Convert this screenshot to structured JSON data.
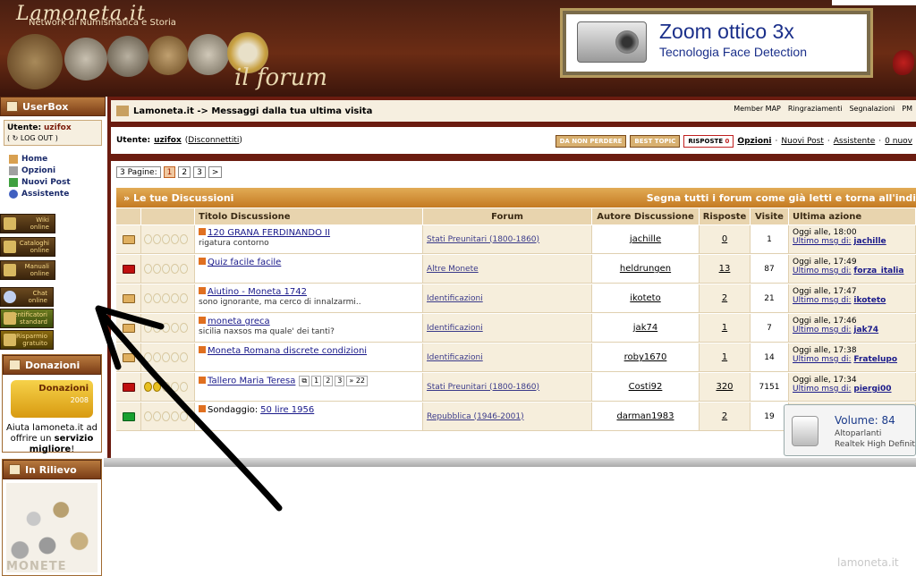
{
  "header": {
    "logo_title": "Lamoneta.it",
    "logo_subtitle": "Network di Numismatica e Storia",
    "forum_word": "il forum",
    "banner": {
      "line1": "Zoom ottico 3x",
      "line2": "Tecnologia Face Detection"
    }
  },
  "sidebar": {
    "userbox_title": "UserBox",
    "user_label": "Utente:",
    "user_name": "uzifox",
    "logout": "LOG OUT",
    "links": [
      "Home",
      "Opzioni",
      "Nuovi Post",
      "Assistente"
    ],
    "side_buttons": [
      {
        "l1": "Wiki",
        "l2": "online"
      },
      {
        "l1": "Cataloghi",
        "l2": "online"
      },
      {
        "l1": "Manuali",
        "l2": "online"
      },
      {
        "l1": "Chat",
        "l2": "online"
      },
      {
        "l1": "Identificatori",
        "l2": "standard"
      },
      {
        "l1": "Risparmio",
        "l2": "gratuito"
      }
    ],
    "donazioni_title": "Donazioni",
    "donazioni_badge": "Donazioni",
    "donazioni_year": "2008",
    "donazioni_text1": "Aiuta lamoneta.it ad",
    "donazioni_text2": "offrire un",
    "donazioni_text3": "servizio",
    "donazioni_text4": "migliore",
    "rilievo_title": "In Rilievo",
    "rilievo_img_text": "MONETE"
  },
  "main": {
    "breadcrumb": "Lamoneta.it -> Messaggi dalla tua ultima visita",
    "top_right": [
      "Member MAP",
      "Ringraziamenti",
      "Segnalazioni",
      "PM"
    ],
    "user_label": "Utente:",
    "user_name": "uzifox",
    "disconnect": "Disconnettiti",
    "userline_links": [
      "Opzioni",
      "Nuovi Post",
      "Assistente",
      "0 nuov"
    ],
    "pills": [
      "DA NON PERDERE",
      "BEST TOPIC",
      "RISPOSTE"
    ],
    "risposte_count": "0",
    "pager_label": "3 Pagine:",
    "pages": [
      "1",
      "2",
      "3",
      ">"
    ],
    "section_title": "Le tue Discussioni",
    "mark_read": "Segna tutti i forum come già letti e torna all'indi",
    "columns": [
      "Titolo Discussione",
      "Forum",
      "Autore Discussione",
      "Risposte",
      "Visite",
      "Ultima azione"
    ],
    "rows": [
      {
        "title": "120 GRANA FERDINANDO II",
        "sub": "rigatura contorno",
        "forum": "Stati Preunitari (1800-1860)",
        "author": "jachille",
        "replies": "0",
        "views": "1",
        "time": "Oggi alle, 18:00",
        "last_label": "Ultimo msg di:",
        "last_user": "jachille",
        "folder": "normal"
      },
      {
        "title": "Quiz facile facile",
        "sub": "",
        "forum": "Altre Monete",
        "author": "heldrungen",
        "replies": "13",
        "views": "87",
        "time": "Oggi alle, 17:49",
        "last_label": "Ultimo msg di:",
        "last_user": "forza_italia",
        "folder": "hot"
      },
      {
        "title": "Aiutino - Moneta 1742",
        "sub": "sono ignorante, ma cerco di innalzarmi..",
        "forum": "Identificazioni",
        "author": "ikoteto",
        "replies": "2",
        "views": "21",
        "time": "Oggi alle, 17:47",
        "last_label": "Ultimo msg di:",
        "last_user": "ikoteto",
        "folder": "normal"
      },
      {
        "title": "moneta greca",
        "sub": "sicilia naxsos ma quale' dei tanti?",
        "forum": "Identificazioni",
        "author": "jak74",
        "replies": "1",
        "views": "7",
        "time": "Oggi alle, 17:46",
        "last_label": "Ultimo msg di:",
        "last_user": "jak74",
        "folder": "normal"
      },
      {
        "title": "Moneta Romana discrete condizioni",
        "sub": "",
        "forum": "Identificazioni",
        "author": "roby1670",
        "replies": "1",
        "views": "14",
        "time": "Oggi alle, 17:38",
        "last_label": "Ultimo msg di:",
        "last_user": "Fratelupo",
        "folder": "normal"
      },
      {
        "title": "Tallero Maria Teresa",
        "sub": "",
        "forum": "Stati Preunitari (1800-1860)",
        "author": "Costi92",
        "replies": "320",
        "views": "7151",
        "time": "Oggi alle, 17:34",
        "last_label": "Ultimo msg di:",
        "last_user": "piergi00",
        "folder": "hot",
        "minipages": [
          "1",
          "2",
          "3",
          "» 22"
        ]
      },
      {
        "title": "50 lire 1956",
        "prefix": "Sondaggio:",
        "sub": "",
        "forum": "Repubblica (1946-2001)",
        "author": "darman1983",
        "replies": "2",
        "views": "19",
        "time": "",
        "last_label": "",
        "last_user": "",
        "folder": "new"
      }
    ]
  },
  "volume": {
    "title": "Volume: 84",
    "l2": "Altoparlanti",
    "l3": "Realtek High Definit"
  },
  "watermark": "lamoneta.it",
  "colors": {
    "header_brown": "#4a1f12",
    "frame_red": "#6b1c10",
    "accent_orange": "#c47a22",
    "link_blue": "#1a1a8a"
  }
}
